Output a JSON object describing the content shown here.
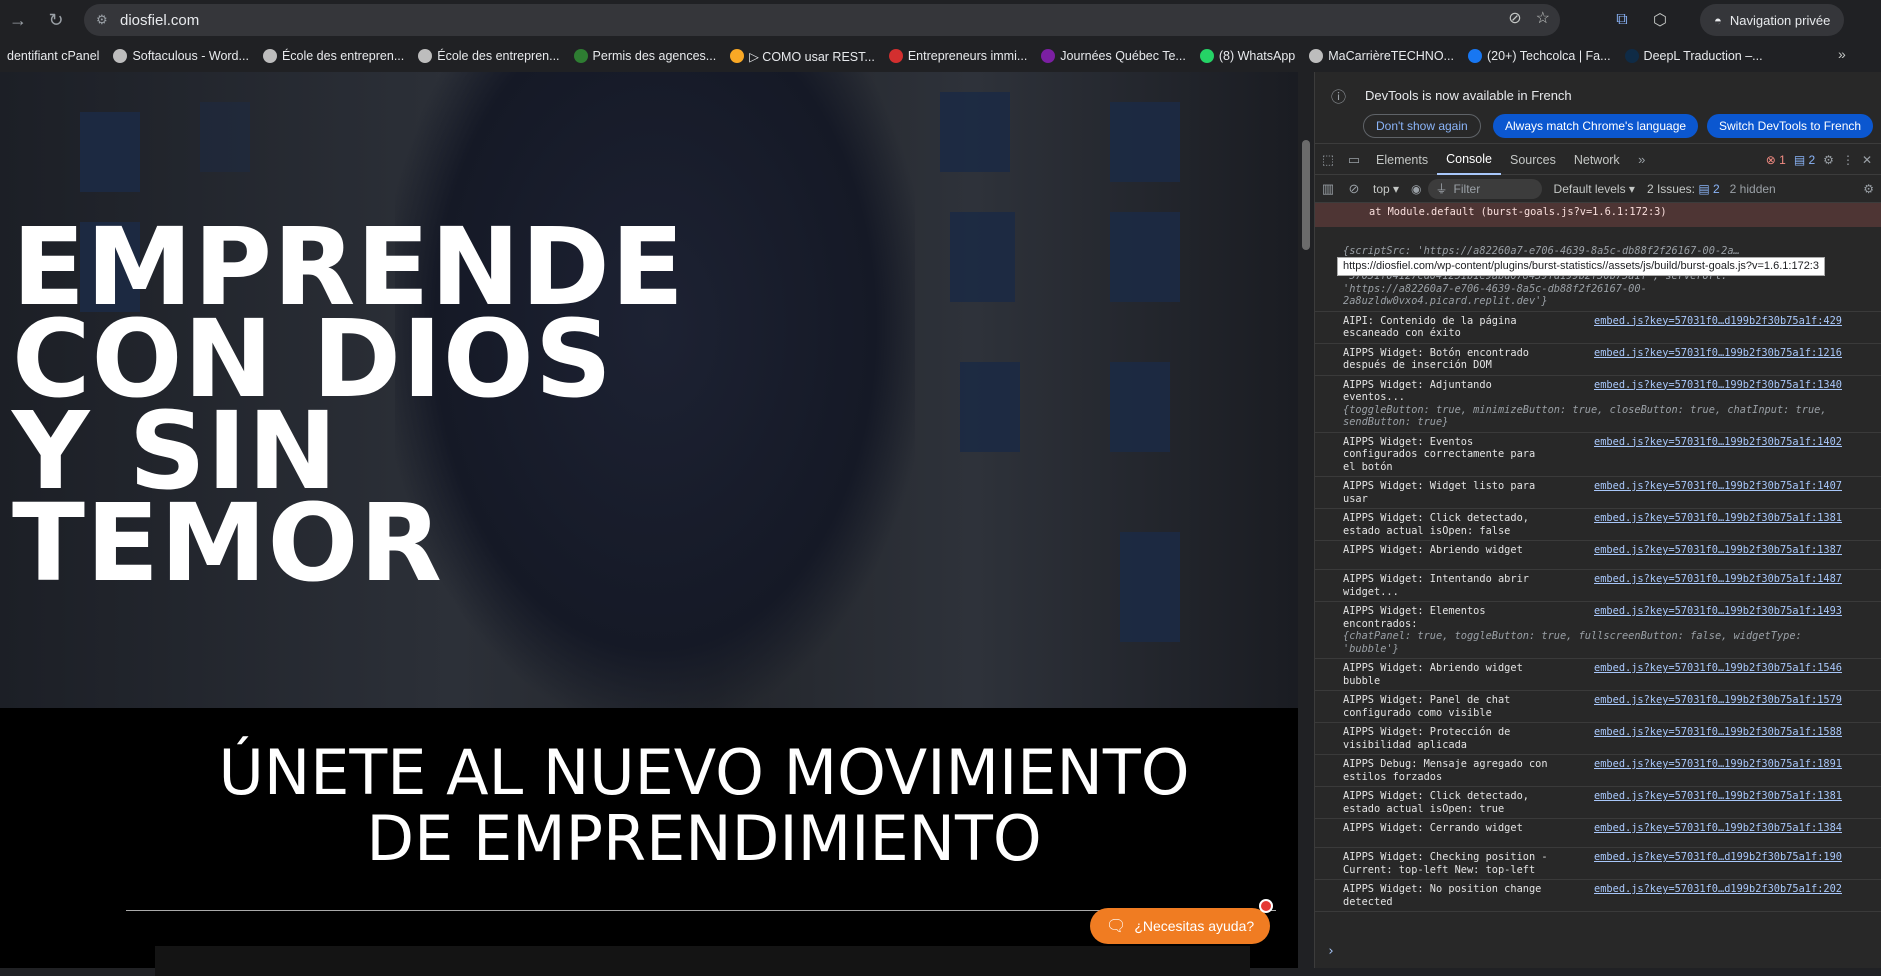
{
  "browser": {
    "url": "diosfiel.com",
    "incognito_label": "Navigation privée",
    "bookmarks": [
      {
        "label": "dentifiant cPanel",
        "color": "#202124"
      },
      {
        "label": "Softaculous - Word...",
        "color": "#bdbdbd"
      },
      {
        "label": "École des entrepren...",
        "color": "#bdbdbd"
      },
      {
        "label": "École des entrepren...",
        "color": "#bdbdbd"
      },
      {
        "label": "Permis des agences...",
        "color": "#2e7d32"
      },
      {
        "label": "▷ COMO usar REST...",
        "color": "#f9a825"
      },
      {
        "label": "Entrepreneurs immi...",
        "color": "#d32f2f"
      },
      {
        "label": "Journées Québec Te...",
        "color": "#7b1fa2"
      },
      {
        "label": "(8) WhatsApp",
        "color": "#25d366"
      },
      {
        "label": "MaCarrièreTECHNO...",
        "color": "#bdbdbd"
      },
      {
        "label": "(20+) Techcolca | Fa...",
        "color": "#1877f2"
      },
      {
        "label": "DeepL Traduction –...",
        "color": "#0f2b46"
      }
    ]
  },
  "page": {
    "hero_lines": [
      "EMPRENDE",
      "CON DIOS",
      "Y SIN",
      "TEMOR"
    ],
    "subtitle_lines": [
      "ÚNETE AL NUEVO MOVIMIENTO",
      "DE EMPRENDIMIENTO"
    ],
    "help_button": "¿Necesitas ayuda?"
  },
  "devtools": {
    "info_message": "DevTools is now available in French",
    "btn_dont_show": "Don't show again",
    "btn_always_match": "Always match Chrome's language",
    "btn_switch": "Switch DevTools to French",
    "tabs": [
      "Elements",
      "Console",
      "Sources",
      "Network"
    ],
    "error_count": "1",
    "message_count": "2",
    "context": "top",
    "filter_placeholder": "Filter",
    "levels": "Default levels",
    "issues_label": "2 Issues:",
    "issues_count": "2",
    "hidden": "2 hidden",
    "error_line": "at Module.default (burst-goals.js?v=1.6.1:172:3)",
    "tooltip": "https://diosfiel.com/wp-content/plugins/burst-statistics//assets/js/build/burst-goals.js?v=1.6.1:172:3",
    "obj_config": "{scriptSrc: 'https://a82260a7-e706-4639-8a5c-db88f2f26167-00-2a…=57031f04127cd041251b1e9abd678439fd199b2f30b75a1f', apiKey: '57031f04127cd041251b1e9abd678439fd199b2f30b75a1f', serverUrl: 'https://a82260a7-e706-4639-8a5c-db88f2f26167-00-2a8uzldw0vxo4.picard.replit.dev'}",
    "logs": [
      {
        "text": "AIPI: Contenido de la página escaneado con éxito",
        "src": "embed.js?key=57031f0…d199b2f30b75a1f:429"
      },
      {
        "text": "AIPPS Widget: Botón encontrado después de inserción DOM",
        "src": "embed.js?key=57031f0…199b2f30b75a1f:1216"
      },
      {
        "text": "AIPPS Widget: Adjuntando eventos...",
        "src": "embed.js?key=57031f0…199b2f30b75a1f:1340",
        "obj": "{toggleButton: true, minimizeButton: true, closeButton: true, chatInput: true, sendButton: true}"
      },
      {
        "text": "AIPPS Widget: Eventos configurados correctamente para el botón",
        "src": "embed.js?key=57031f0…199b2f30b75a1f:1402"
      },
      {
        "text": "AIPPS Widget: Widget listo para usar",
        "src": "embed.js?key=57031f0…199b2f30b75a1f:1407"
      },
      {
        "text": "AIPPS Widget: Click detectado, estado actual isOpen: false",
        "src": "embed.js?key=57031f0…199b2f30b75a1f:1381"
      },
      {
        "text": "AIPPS Widget: Abriendo widget",
        "src": "embed.js?key=57031f0…199b2f30b75a1f:1387"
      },
      {
        "text": "AIPPS Widget: Intentando abrir widget...",
        "src": "embed.js?key=57031f0…199b2f30b75a1f:1487"
      },
      {
        "text": "AIPPS Widget: Elementos encontrados:",
        "src": "embed.js?key=57031f0…199b2f30b75a1f:1493",
        "obj": "{chatPanel: true, toggleButton: true, fullscreenButton: false, widgetType: 'bubble'}"
      },
      {
        "text": "AIPPS Widget: Abriendo widget bubble",
        "src": "embed.js?key=57031f0…199b2f30b75a1f:1546"
      },
      {
        "text": "AIPPS Widget: Panel de chat configurado como visible",
        "src": "embed.js?key=57031f0…199b2f30b75a1f:1579"
      },
      {
        "text": "AIPPS Widget: Protección de visibilidad aplicada",
        "src": "embed.js?key=57031f0…199b2f30b75a1f:1588"
      },
      {
        "text": "AIPPS Debug: Mensaje agregado con estilos forzados",
        "src": "embed.js?key=57031f0…199b2f30b75a1f:1891"
      },
      {
        "text": "AIPPS Widget: Click detectado, estado actual isOpen: true",
        "src": "embed.js?key=57031f0…199b2f30b75a1f:1381"
      },
      {
        "text": "AIPPS Widget: Cerrando widget",
        "src": "embed.js?key=57031f0…199b2f30b75a1f:1384"
      },
      {
        "text": "AIPPS Widget: Checking position - Current: top-left New: top-left",
        "src": "embed.js?key=57031f0…d199b2f30b75a1f:190"
      },
      {
        "text": "AIPPS Widget: No position change detected",
        "src": "embed.js?key=57031f0…d199b2f30b75a1f:202"
      }
    ]
  }
}
